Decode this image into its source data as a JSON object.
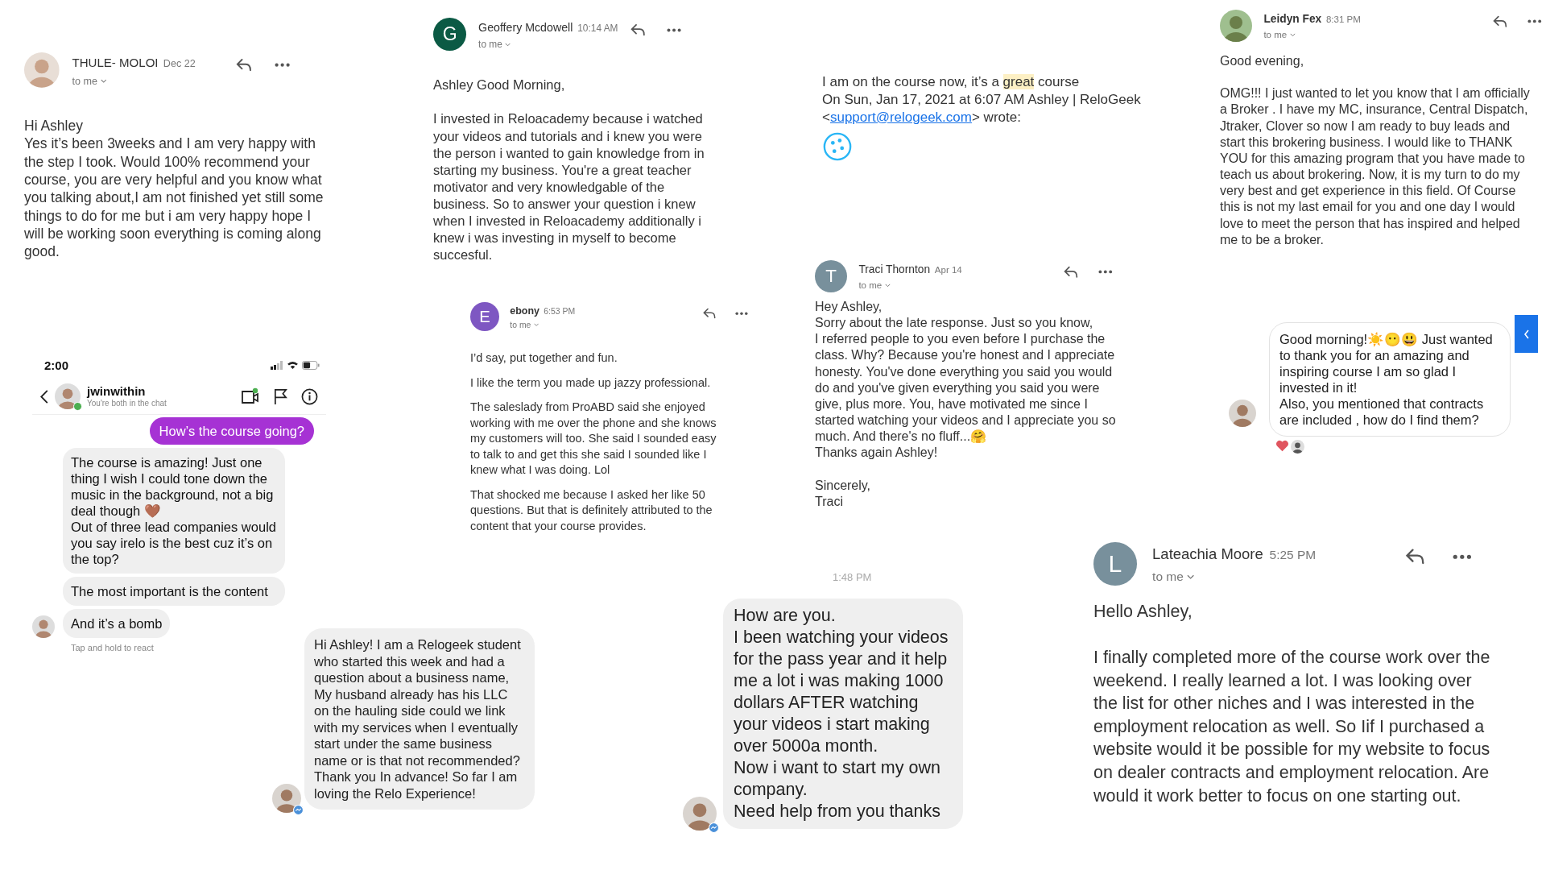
{
  "emails": [
    {
      "avatar": {
        "kind": "photo"
      },
      "sender": "THULE- MOLOI",
      "time": "Dec 22",
      "recipient": "to me",
      "paragraphs": [
        "Hi Ashley\nYes it’s been 3weeks and I am very happy with the step I took. Would 100% recommend your course, you are very helpful and you know what you talking about,I am not finished yet still some things to do for me but i am very happy hope I will be working soon everything is coming along good."
      ]
    },
    {
      "avatar": {
        "kind": "letter",
        "letter": "G",
        "color": "#0b5a44"
      },
      "sender": "Geoffery Mcdowell",
      "time": "10:14 AM",
      "recipient": "to me",
      "paragraphs": [
        "Ashley Good Morning,",
        "I invested in Reloacademy because i watched your videos and tutorials and i knew you were the person i wanted to gain knowledge from in starting my business. You're a great teacher motivator and very knowledgable of the business. So to answer your question i knew when I invested in Reloacademy additionally i knew i was investing in myself to become succesful."
      ]
    },
    {
      "avatar": {
        "kind": "letter",
        "letter": "E",
        "color": "#7e57c2"
      },
      "sender": "ebony",
      "time": "6:53 PM",
      "recipient": "to me",
      "paragraphs": [
        "I’d say, put together and fun.",
        "I like the term you made up jazzy professional.",
        "The saleslady from ProABD said she enjoyed working with me over the phone and she knows my customers will too.  She said I sounded easy to talk to and get this she said I sounded like I knew what I was doing. Lol",
        "That shocked me because I asked her like 50 questions.  But that is definitely attributed to the content that your course provides."
      ]
    },
    {
      "avatar": {
        "kind": "letter",
        "letter": "T",
        "color": "#78909c"
      },
      "sender": "Traci Thornton",
      "time": "Apr 14",
      "recipient": "to me",
      "paragraphs": [
        "Hey Ashley,\n Sorry about the late response.  Just so you know,\n I referred people to you even before I purchase the class.  Why? Because you're honest and I appreciate honesty.  You've done everything you said you would do and you've given everything you said you were give, plus more.  You, have motivated me since I started watching your videos and I appreciate you so much.  And there's no fluff...🤗\nThanks again Ashley!",
        "Sincerely,\nTraci"
      ]
    },
    {
      "avatar": {
        "kind": "photo"
      },
      "sender": "Leidyn Fex",
      "time": "8:31 PM",
      "recipient": "to me",
      "paragraphs": [
        "Good evening,",
        "OMG!!! I just wanted to let you know that I am officially a Broker . I have my MC, insurance, Central Dispatch, Jtraker, Clover so now I am ready to buy leads and start this brokering business. I would like to THANK YOU for this amazing program that you have made to teach us about brokering. Now, it is my turn to do my very best and get experience in this field. Of Course this is not my last email for you and one day I would love to meet the person that has inspired and helped me to be a broker."
      ]
    },
    {
      "avatar": {
        "kind": "letter",
        "letter": "L",
        "color": "#78909c"
      },
      "sender": "Lateachia Moore",
      "time": "5:25 PM",
      "recipient": "to me",
      "paragraphs": [
        "Hello Ashley,",
        "I finally completed more of the course work over the weekend. I really learned a lot. I was looking over the list for other niches and I was interested in the employment relocation as well. So Iif I purchased  a website would it be possible for my website to focus on dealer contracts and employment relocation.  Are would it work better to focus on one starting out."
      ]
    }
  ],
  "reply_excerpt": {
    "text": "I am on the course now, it’s a **great** course",
    "quote_before": "On Sun, Jan 17, 2021 at 6:07 AM Ashley | ReloGeek <",
    "quote_link": "support@relogeek.com",
    "quote_after": "> wrote:"
  },
  "direct_chat": {
    "status_bar": {
      "time": "2:00"
    },
    "contact": {
      "name": "jwinwithin",
      "status": "You're both in the chat",
      "online": true
    },
    "messages": [
      {
        "outgoing": true,
        "text": "How’s the course going?"
      },
      {
        "outgoing": false,
        "text": "The course is amazing! Just one thing I wish I could tone down the music in the background, not a big deal though 🤎\nOut of three lead companies would you say irelo is the best cuz it’s on the top?"
      },
      {
        "outgoing": false,
        "text": "The most important is the content"
      },
      {
        "outgoing": false,
        "text": "And it’s a bomb"
      }
    ],
    "hint": "Tap and hold to react"
  },
  "message_bubbles": [
    {
      "kind": "filled",
      "text": "Hi Ashley! I am a Relogeek student who started this week and had a question about a business name, My husband already has his LLC on the hauling side could we link with my services when I eventually start under the same business name or is that not recommended? Thank you In advance! So far I am loving the Relo Experience!",
      "reacted": false
    },
    {
      "kind": "filled",
      "timestamp": "1:48 PM",
      "text": "How are you.\nI been watching your videos for the pass year and it help me a lot i was making 1000 dollars AFTER watching your videos i start making over 5000a month.\nNow i want to start my own company.\nNeed help from you thanks",
      "reacted": false
    },
    {
      "kind": "outlined",
      "text": "Good morning!☀️😶😃 Just wanted to thank you for an amazing and inspiring course I am so glad I invested in it!\nAlso, you mentioned that contracts are included , how do I find them?",
      "reacted": true
    }
  ]
}
